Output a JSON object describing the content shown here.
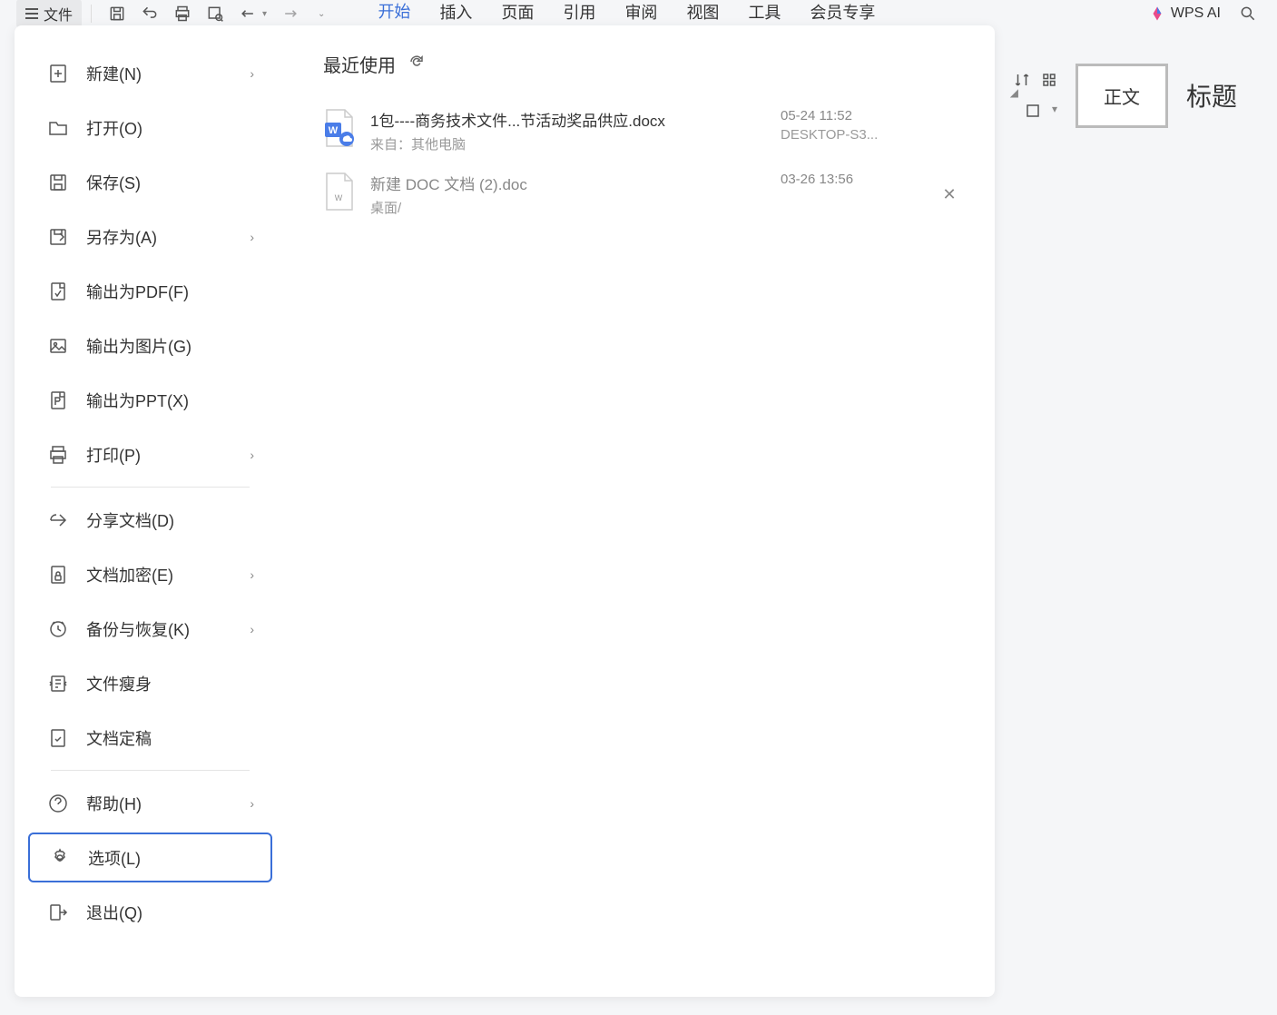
{
  "toolbar": {
    "file_label": "文件"
  },
  "tabs": [
    "开始",
    "插入",
    "页面",
    "引用",
    "审阅",
    "视图",
    "工具",
    "会员专享"
  ],
  "wps_ai_label": "WPS AI",
  "sidebar": {
    "items": [
      {
        "label": "新建(N)",
        "icon": "plus-doc",
        "has_chevron": true
      },
      {
        "label": "打开(O)",
        "icon": "folder",
        "has_chevron": false
      },
      {
        "label": "保存(S)",
        "icon": "save",
        "has_chevron": false
      },
      {
        "label": "另存为(A)",
        "icon": "save-as",
        "has_chevron": true
      },
      {
        "label": "输出为PDF(F)",
        "icon": "pdf",
        "has_chevron": false
      },
      {
        "label": "输出为图片(G)",
        "icon": "image",
        "has_chevron": false
      },
      {
        "label": "输出为PPT(X)",
        "icon": "ppt",
        "has_chevron": false
      },
      {
        "label": "打印(P)",
        "icon": "print",
        "has_chevron": true
      },
      {
        "divider": true
      },
      {
        "label": "分享文档(D)",
        "icon": "share",
        "has_chevron": false
      },
      {
        "label": "文档加密(E)",
        "icon": "lock",
        "has_chevron": true
      },
      {
        "label": "备份与恢复(K)",
        "icon": "backup",
        "has_chevron": true
      },
      {
        "label": "文件瘦身",
        "icon": "slim",
        "has_chevron": false
      },
      {
        "label": "文档定稿",
        "icon": "finalize",
        "has_chevron": false
      },
      {
        "divider": true
      },
      {
        "label": "帮助(H)",
        "icon": "help",
        "has_chevron": true
      },
      {
        "label": "选项(L)",
        "icon": "settings",
        "has_chevron": false,
        "selected": true
      },
      {
        "label": "退出(Q)",
        "icon": "exit",
        "has_chevron": false
      }
    ]
  },
  "content": {
    "title": "最近使用",
    "files": [
      {
        "name": "1包----商务技术文件...节活动奖品供应.docx",
        "source": "来自：其他电脑",
        "time": "05-24 11:52",
        "location": "DESKTOP-S3...",
        "type": "docx",
        "show_close": false
      },
      {
        "name": "新建 DOC 文档 (2).doc",
        "source": "桌面/",
        "time": "03-26 13:56",
        "location": "",
        "type": "doc",
        "show_close": true,
        "secondary": true
      }
    ]
  },
  "styles": {
    "body_text": "正文",
    "heading": "标题"
  }
}
